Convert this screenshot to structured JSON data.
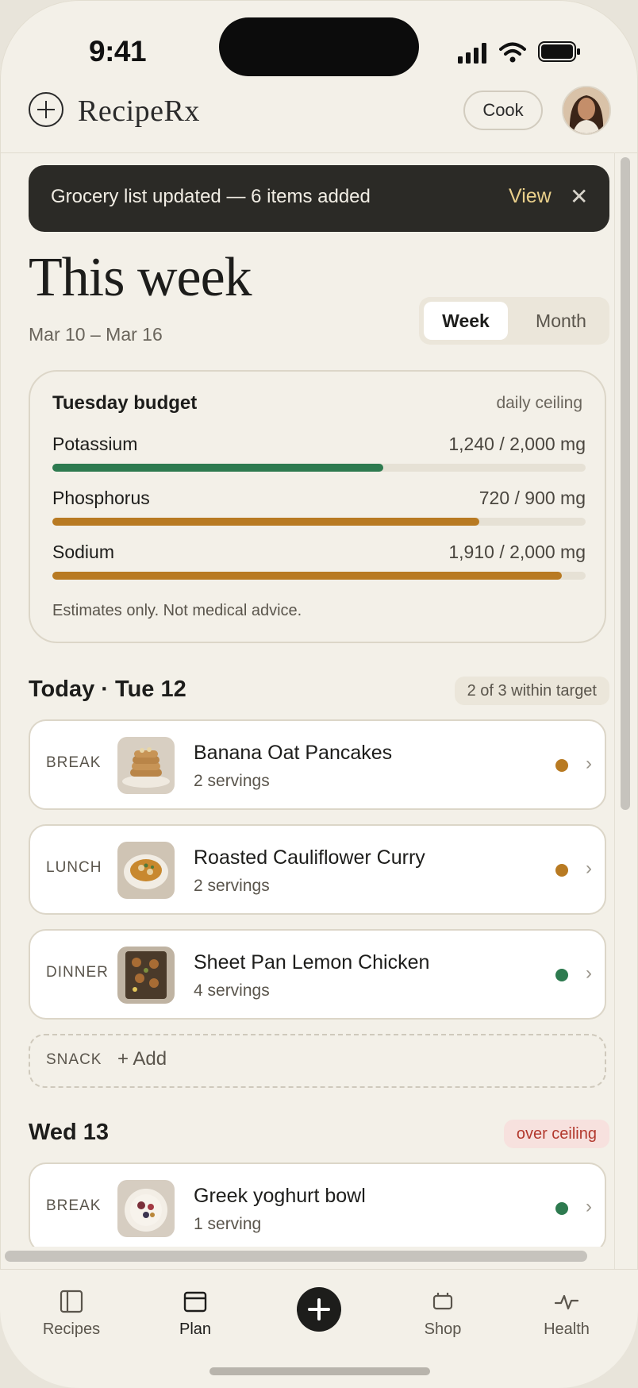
{
  "status": {
    "time": "9:41"
  },
  "header": {
    "brand": "RecipeRx",
    "cook_label": "Cook"
  },
  "toast": {
    "message": "Grocery list updated — 6 items added",
    "action": "View",
    "close": "✕"
  },
  "page": {
    "title": "This week",
    "date_range": "Mar 10 – Mar 16",
    "toggle": {
      "week": "Week",
      "month": "Month",
      "selected": "Week"
    }
  },
  "budget": {
    "title": "Tuesday budget",
    "note": "daily ceiling",
    "nutrients": [
      {
        "label": "Potassium",
        "value": "1,240 / 2,000 mg",
        "fraction": 0.62,
        "color": "#2d7a4f"
      },
      {
        "label": "Phosphorus",
        "value": "720 / 900 mg",
        "fraction": 0.8,
        "color": "#b87a22"
      },
      {
        "label": "Sodium",
        "value": "1,910 / 2,000 mg",
        "fraction": 0.955,
        "color": "#b87a22"
      }
    ],
    "disclaimer": "Estimates only. Not medical advice."
  },
  "days": [
    {
      "heading": "Today · Tue 12",
      "badge": "2 of 3 within target",
      "meals": [
        {
          "type": "BREAK",
          "name": "Banana Oat Pancakes",
          "servings": "2 servings",
          "status_color": "#b87a22"
        },
        {
          "type": "LUNCH",
          "name": "Roasted Cauliflower Curry",
          "servings": "2 servings",
          "status_color": "#b87a22"
        },
        {
          "type": "DINNER",
          "name": "Sheet Pan Lemon Chicken",
          "servings": "4 servings",
          "status_color": "#2d7a4f"
        }
      ],
      "snack": {
        "type": "SNACK",
        "add_label": "+ Add"
      }
    },
    {
      "heading": "Wed 13",
      "badge": "over ceiling",
      "meals": [
        {
          "type": "BREAK",
          "name": "Greek yoghurt bowl",
          "servings": "1 serving",
          "status_color": "#2d7a4f"
        }
      ]
    }
  ],
  "tabs": [
    {
      "label": "Recipes",
      "icon": "book-icon"
    },
    {
      "label": "Plan",
      "icon": "calendar-icon",
      "active": true
    },
    {
      "label": "Add",
      "icon": "plus-icon"
    },
    {
      "label": "Shop",
      "icon": "basket-icon"
    },
    {
      "label": "Health",
      "icon": "pulse-icon"
    }
  ],
  "colors": {
    "background": "#f3f0e8",
    "toast": "#2b2a26",
    "accent_gold": "#e9cf8a",
    "ok_green": "#2d7a4f",
    "warn_amber": "#b87a22",
    "over_red": "#b2382d"
  }
}
